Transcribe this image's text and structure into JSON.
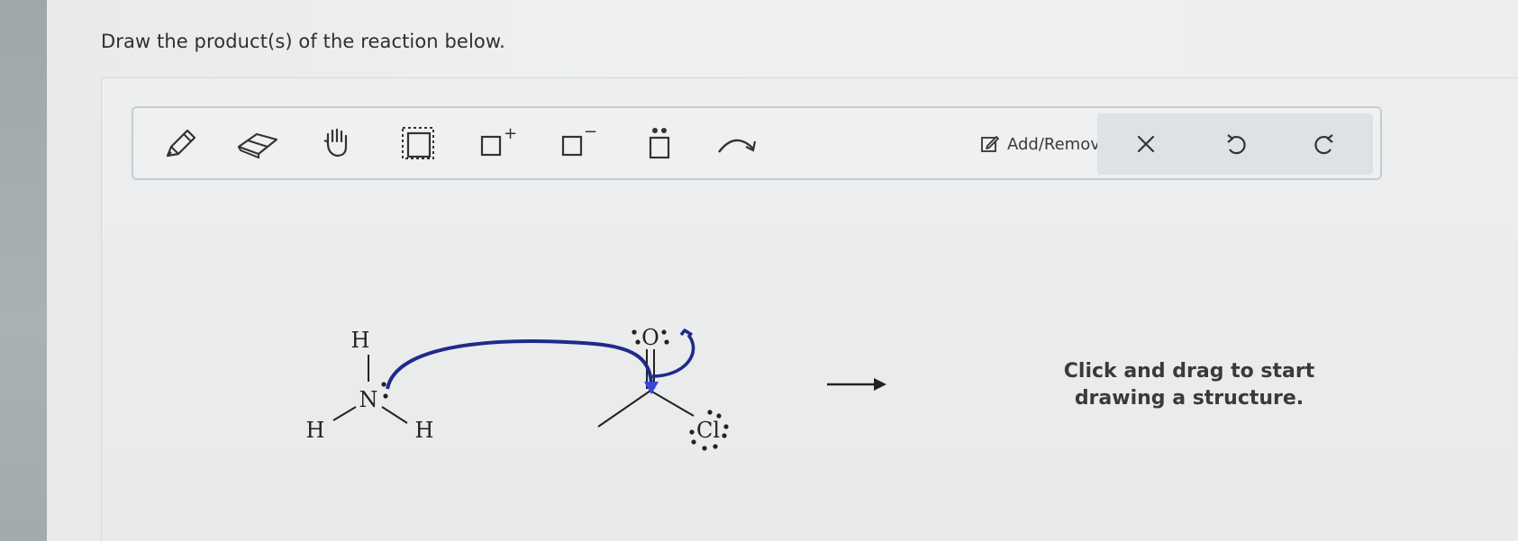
{
  "prompt": "Draw the product(s) of the reaction below.",
  "toolbar": {
    "tools": [
      {
        "icon": "pencil-icon"
      },
      {
        "icon": "eraser-icon"
      },
      {
        "icon": "hand-icon"
      },
      {
        "icon": "select-box-icon"
      },
      {
        "icon": "positive-charge-icon",
        "symbol": "+"
      },
      {
        "icon": "negative-charge-icon",
        "symbol": "−"
      },
      {
        "icon": "lone-pair-icon"
      },
      {
        "icon": "curved-arrow-icon"
      }
    ],
    "step_label": "Add/Remove step",
    "actions": [
      {
        "icon": "close-icon"
      },
      {
        "icon": "undo-icon"
      },
      {
        "icon": "redo-icon"
      }
    ]
  },
  "reaction": {
    "nucleophile": {
      "center": "N",
      "substituents": [
        "H",
        "H",
        "H"
      ]
    },
    "electrophile": {
      "carbonyl_oxygen": "O",
      "leaving_group": "Cl"
    },
    "arrow_color": "#1f2a8a"
  },
  "canvas_hint": "Click and drag to start drawing a structure."
}
